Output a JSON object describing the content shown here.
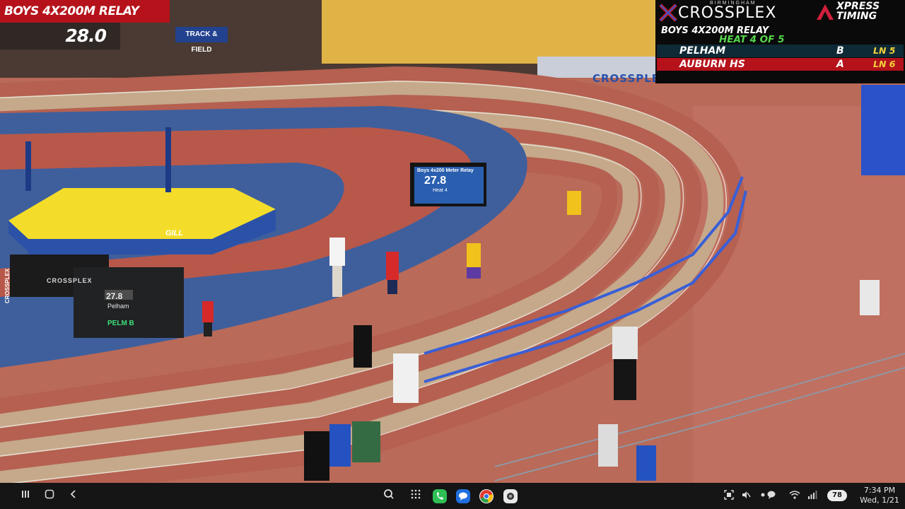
{
  "overlay": {
    "event_title": "BOYS 4X200M RELAY",
    "clock": "28.0"
  },
  "scoreboard": {
    "brand_top": "BIRMINGHAM",
    "brand_name": "CROSSPLEX",
    "sponsor_line1": "XPRESS",
    "sponsor_line2": "TIMING",
    "event": "BOYS 4X200M RELAY",
    "heat": "HEAT 4 OF 5",
    "rows": [
      {
        "team": "PELHAM",
        "leg": "B",
        "lane": "LN 5"
      },
      {
        "team": "AUBURN HS",
        "leg": "A",
        "lane": "LN 6"
      }
    ]
  },
  "venue": {
    "banner_track_field": "TRACK & FIELD",
    "wall_crossplex": "CROSSPLEX",
    "board_title": "Boys 4x200 Meter Relay",
    "board_time": "27.8",
    "board_heat": "Heat 4",
    "table_time": "27.8",
    "table_team": "Pelham",
    "table_team_line2": "PELM B",
    "pit_brand": "GILL",
    "table_brand": "CROSSPLEX",
    "side_brand": "CROSSPLEX"
  },
  "navbar": {
    "battery": "78",
    "time": "7:34 PM",
    "date": "Wed, 1/21",
    "icons": [
      "recents-icon",
      "home-icon",
      "back-icon",
      "search-icon",
      "apps-icon",
      "phone-icon",
      "messages-icon",
      "chrome-icon",
      "camera-icon"
    ]
  }
}
